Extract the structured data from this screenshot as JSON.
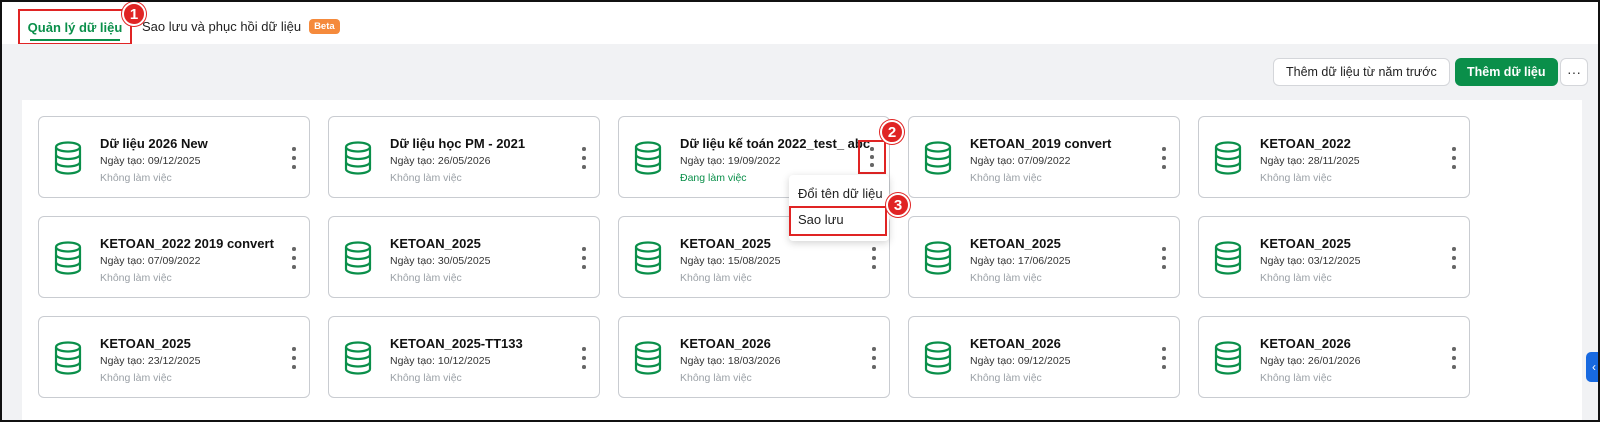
{
  "tabs": {
    "data_management": "Quản lý dữ liệu",
    "backup_restore": "Sao lưu và phục hồi dữ liệu",
    "beta_badge": "Beta"
  },
  "markers": [
    "1",
    "2",
    "3"
  ],
  "toolbar": {
    "add_from_prev_year": "Thêm dữ liệu từ năm trước",
    "add_data": "Thêm dữ liệu",
    "more": "···"
  },
  "cards": [
    {
      "name": "Dữ liệu 2026 New",
      "date": "Ngày tạo: 09/12/2025",
      "status": "Không làm việc"
    },
    {
      "name": "Dữ liệu học PM - 2021",
      "date": "Ngày tạo: 26/05/2026",
      "status": "Không làm việc"
    },
    {
      "name": "Dữ liệu kế toán 2022_test_ abc",
      "date": "Ngày tạo: 19/09/2022",
      "status": "Đang làm việc"
    },
    {
      "name": "KETOAN_2019 convert",
      "date": "Ngày tạo: 07/09/2022",
      "status": "Không làm việc"
    },
    {
      "name": "KETOAN_2022",
      "date": "Ngày tạo: 28/11/2025",
      "status": "Không làm việc"
    },
    {
      "name": "KETOAN_2022 2019 convert",
      "date": "Ngày tạo: 07/09/2022",
      "status": "Không làm việc"
    },
    {
      "name": "KETOAN_2025",
      "date": "Ngày tạo: 30/05/2025",
      "status": "Không làm việc"
    },
    {
      "name": "KETOAN_2025",
      "date": "Ngày tạo: 15/08/2025",
      "status": "Không làm việc"
    },
    {
      "name": "KETOAN_2025",
      "date": "Ngày tạo: 17/06/2025",
      "status": "Không làm việc"
    },
    {
      "name": "KETOAN_2025",
      "date": "Ngày tạo: 03/12/2025",
      "status": "Không làm việc"
    },
    {
      "name": "KETOAN_2025",
      "date": "Ngày tạo: 23/12/2025",
      "status": "Không làm việc"
    },
    {
      "name": "KETOAN_2025-TT133",
      "date": "Ngày tạo: 10/12/2025",
      "status": "Không làm việc"
    },
    {
      "name": "KETOAN_2026",
      "date": "Ngày tạo: 18/03/2026",
      "status": "Không làm việc"
    },
    {
      "name": "KETOAN_2026",
      "date": "Ngày tạo: 09/12/2025",
      "status": "Không làm việc"
    },
    {
      "name": "KETOAN_2026",
      "date": "Ngày tạo: 26/01/2026",
      "status": "Không làm việc"
    }
  ],
  "context_menu": {
    "rename": "Đổi tên dữ liệu",
    "backup": "Sao lưu"
  },
  "side_toggle_icon": "‹",
  "colors": {
    "brand_green": "#0a8f4a",
    "annotation_red": "#e02424",
    "beta_orange": "#f58a3c",
    "toggle_blue": "#1769e0"
  }
}
